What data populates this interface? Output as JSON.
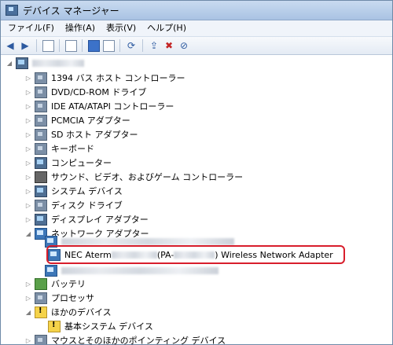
{
  "window": {
    "title": "デバイス マネージャー"
  },
  "menubar": [
    {
      "label": "ファイル(F)"
    },
    {
      "label": "操作(A)"
    },
    {
      "label": "表示(V)"
    },
    {
      "label": "ヘルプ(H)"
    }
  ],
  "tree": {
    "root": "",
    "categories": [
      {
        "label": "1394 バス ホスト コントローラー"
      },
      {
        "label": "DVD/CD-ROM ドライブ"
      },
      {
        "label": "IDE ATA/ATAPI コントローラー"
      },
      {
        "label": "PCMCIA アダプター"
      },
      {
        "label": "SD ホスト アダプター"
      },
      {
        "label": "キーボード"
      },
      {
        "label": "コンピューター"
      },
      {
        "label": "サウンド、ビデオ、およびゲーム コントローラー"
      },
      {
        "label": "システム デバイス"
      },
      {
        "label": "ディスク ドライブ"
      },
      {
        "label": "ディスプレイ アダプター"
      },
      {
        "label": "ネットワーク アダプター"
      }
    ],
    "network_children": {
      "selected_prefix": "NEC Aterm",
      "selected_middle": "(PA-",
      "selected_suffix": ") Wireless Network Adapter"
    },
    "after": [
      {
        "label": "バッテリ"
      },
      {
        "label": "プロセッサ"
      },
      {
        "label": "ほかのデバイス"
      }
    ],
    "other_child": "基本システム デバイス",
    "last": "マウスとそのほかのポインティング デバイス"
  }
}
